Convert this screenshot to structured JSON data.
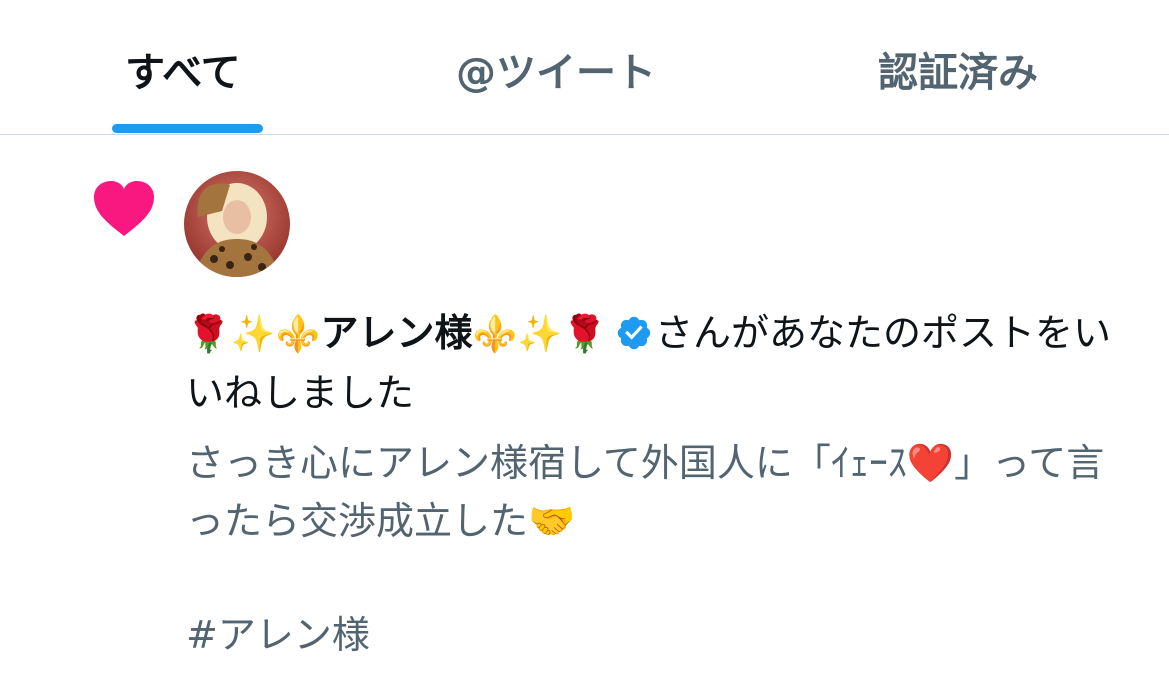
{
  "tabs": {
    "all_label": "すべて",
    "tweets_label": "@ツイート",
    "verified_label": "認証済み"
  },
  "notification": {
    "icon": "heart-icon",
    "icon_color": "#f91880",
    "name_prefix_emoji": "🌹✨⚜️",
    "name": "アレン様",
    "name_suffix_emoji": "⚜️✨🌹",
    "verified_color": "#1d9bf0",
    "action_text": "さんがあなたのポストをいいねしました",
    "tweet_text": "さっき心にアレン様宿して外国人に「ｲｪｰｽ❤️」って言ったら交渉成立した🤝",
    "hashtag": "#アレン様"
  },
  "colors": {
    "accent": "#1d9bf0",
    "primary_text": "#0f1419",
    "secondary_text": "#536471"
  }
}
